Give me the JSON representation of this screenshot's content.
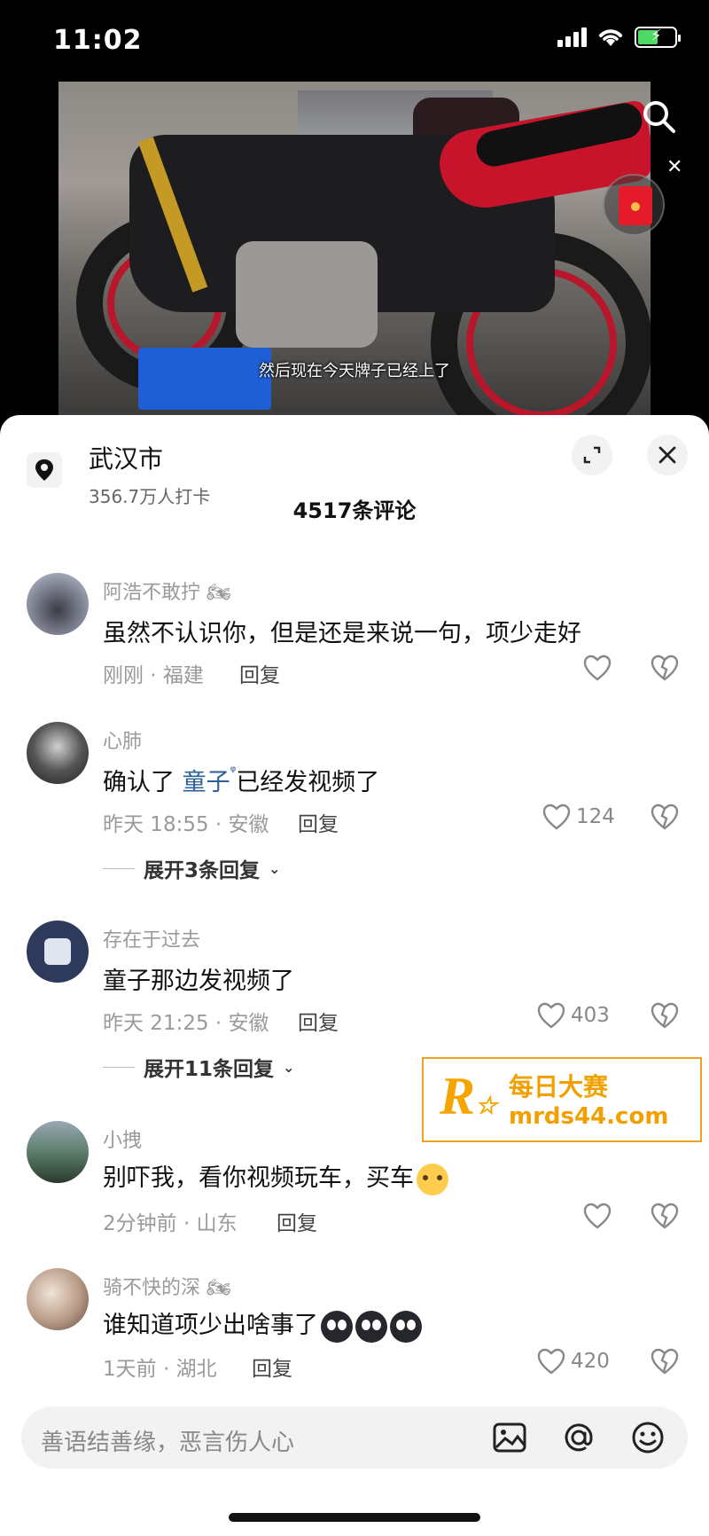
{
  "status_bar": {
    "time": "11:02"
  },
  "video": {
    "subtitle": "然后现在今天牌子已经上了"
  },
  "sheet": {
    "location_title": "武汉市",
    "location_subtitle": "356.7万人打卡",
    "comment_count": "4517条评论"
  },
  "comments": [
    {
      "name": "阿浩不敢拧",
      "text": "虽然不认识你，但是还是来说一句，项少走好",
      "meta": "刚刚 · 福建",
      "reply": "回复",
      "likes": ""
    },
    {
      "name": "心肺",
      "text_before": "确认了 ",
      "mention": "童子",
      "text_after": "已经发视频了",
      "meta": "昨天 18:55 · 安徽",
      "reply": "回复",
      "likes": "124",
      "expand": "展开3条回复"
    },
    {
      "name": "存在于过去",
      "text": "童子那边发视频了",
      "meta": "昨天 21:25 · 安徽",
      "reply": "回复",
      "likes": "403",
      "expand": "展开11条回复"
    },
    {
      "name": "小拽",
      "text": "别吓我，看你视频玩车，买车",
      "meta": "2分钟前 · 山东",
      "reply": "回复",
      "likes": ""
    },
    {
      "name": "骑不快的深",
      "text": "谁知道项少出啥事了",
      "meta": "1天前 · 湖北",
      "reply": "回复",
      "likes": "420"
    }
  ],
  "watermark": {
    "title": "每日大赛",
    "url": "mrds44.com"
  },
  "input": {
    "placeholder": "善语结善缘，恶言伤人心"
  },
  "colors": {
    "accent_red": "#c8142a",
    "mention_blue": "#2d5f99",
    "watermark_orange": "#f2a000"
  }
}
